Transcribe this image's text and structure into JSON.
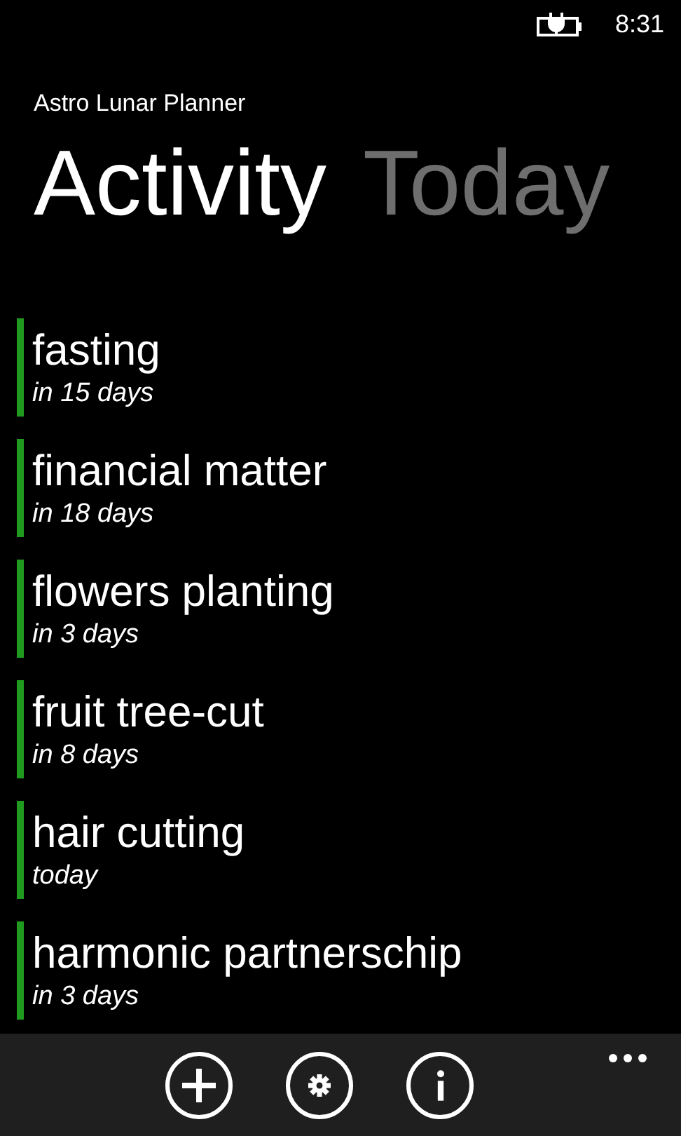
{
  "status_bar": {
    "charging": true,
    "time": "8:31"
  },
  "app_title": "Astro Lunar Planner",
  "pivot": [
    {
      "label": "Activity",
      "selected": true
    },
    {
      "label": "Today",
      "selected": false
    }
  ],
  "activities": [
    {
      "name": "fasting",
      "when": "in 15 days"
    },
    {
      "name": "financial matter",
      "when": "in 18 days"
    },
    {
      "name": "flowers planting",
      "when": "in 3 days"
    },
    {
      "name": "fruit tree-cut",
      "when": "in 8 days"
    },
    {
      "name": "hair cutting",
      "when": "today"
    },
    {
      "name": "harmonic partnerschip",
      "when": "in 3 days"
    }
  ],
  "app_bar": {
    "buttons": [
      {
        "kind": "add"
      },
      {
        "kind": "settings"
      },
      {
        "kind": "info"
      }
    ],
    "more_menu": true
  }
}
